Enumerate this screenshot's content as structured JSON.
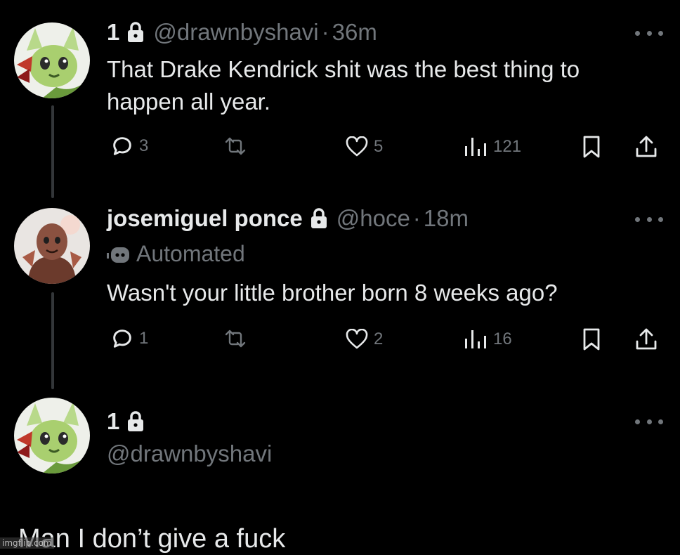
{
  "tweets": [
    {
      "display_name": "1",
      "handle": "@drawnbyshavi",
      "time": "36m",
      "text_line1": "That Drake Kendrick shit was the best thing to",
      "text_line2": "happen all year.",
      "replies": "3",
      "likes": "5",
      "views": "121",
      "avatar": "green-pokemon-avatar"
    },
    {
      "display_name": "josemiguel ponce",
      "handle": "@hoce",
      "time": "18m",
      "label": "Automated",
      "text": "Wasn't your little brother born 8 weeks ago?",
      "replies": "1",
      "likes": "2",
      "views": "16",
      "avatar": "anime-character-avatar"
    },
    {
      "display_name": "1",
      "handle": "@drawnbyshavi",
      "text": "Man I don’t give a fuck",
      "avatar": "green-pokemon-avatar"
    }
  ],
  "separator": "·",
  "watermark": "imgflip.com",
  "colors": {
    "background": "#000000",
    "text": "#e7e9ea",
    "muted": "#71767b",
    "thread_line": "#333639"
  }
}
